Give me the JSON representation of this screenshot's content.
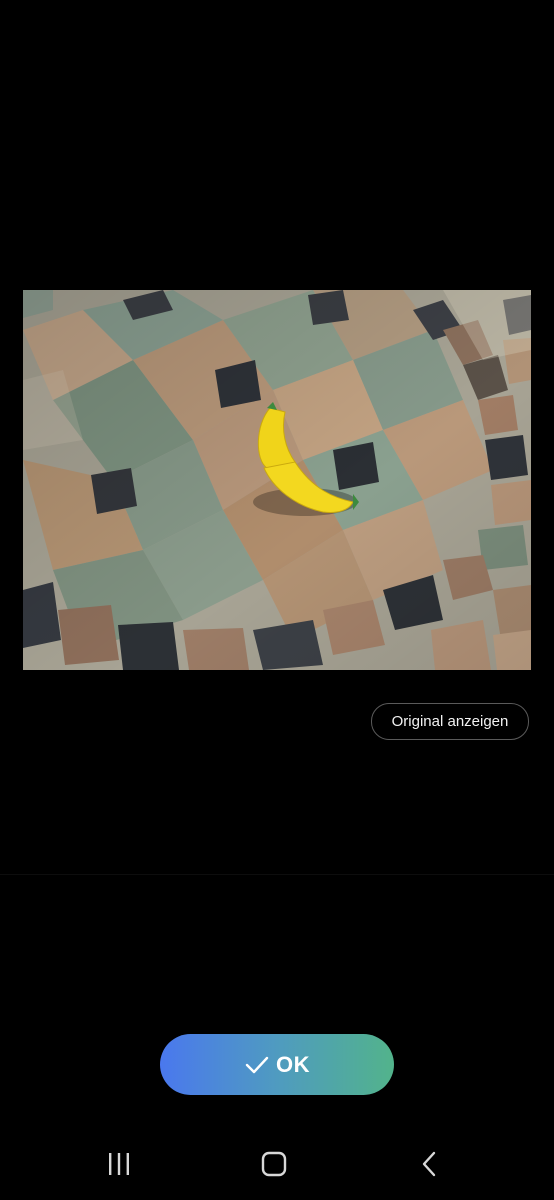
{
  "photo": {
    "subject": "yellow toy banana on mosaic tile table"
  },
  "buttons": {
    "show_original": "Original anzeigen",
    "ok": "OK"
  },
  "icons": {
    "ok_check": "checkmark-icon",
    "nav_recents": "recent-apps-icon",
    "nav_home": "home-icon",
    "nav_back": "back-icon"
  },
  "colors": {
    "background": "#000000",
    "ok_gradient_start": "#4a78ee",
    "ok_gradient_end": "#52b38b"
  }
}
